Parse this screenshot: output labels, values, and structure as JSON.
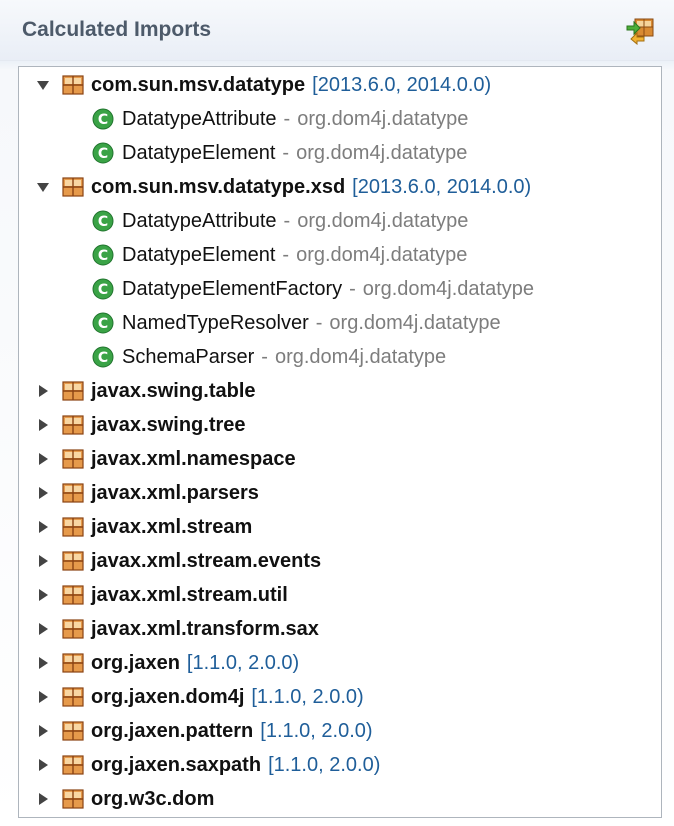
{
  "title": "Calculated Imports",
  "header_icon": "refresh-imports-icon",
  "tree": [
    {
      "name": "com.sun.msv.datatype",
      "version": "[2013.6.0, 2014.0.0)",
      "expanded": true,
      "classes": [
        {
          "name": "DatatypeAttribute",
          "sep": "-",
          "pkg": "org.dom4j.datatype"
        },
        {
          "name": "DatatypeElement",
          "sep": "-",
          "pkg": "org.dom4j.datatype"
        }
      ]
    },
    {
      "name": "com.sun.msv.datatype.xsd",
      "version": "[2013.6.0, 2014.0.0)",
      "expanded": true,
      "classes": [
        {
          "name": "DatatypeAttribute",
          "sep": "-",
          "pkg": "org.dom4j.datatype"
        },
        {
          "name": "DatatypeElement",
          "sep": "-",
          "pkg": "org.dom4j.datatype"
        },
        {
          "name": "DatatypeElementFactory",
          "sep": "-",
          "pkg": "org.dom4j.datatype"
        },
        {
          "name": "NamedTypeResolver",
          "sep": "-",
          "pkg": "org.dom4j.datatype"
        },
        {
          "name": "SchemaParser",
          "sep": "-",
          "pkg": "org.dom4j.datatype"
        }
      ]
    },
    {
      "name": "javax.swing.table",
      "version": "",
      "expanded": false,
      "classes": []
    },
    {
      "name": "javax.swing.tree",
      "version": "",
      "expanded": false,
      "classes": []
    },
    {
      "name": "javax.xml.namespace",
      "version": "",
      "expanded": false,
      "classes": []
    },
    {
      "name": "javax.xml.parsers",
      "version": "",
      "expanded": false,
      "classes": []
    },
    {
      "name": "javax.xml.stream",
      "version": "",
      "expanded": false,
      "classes": []
    },
    {
      "name": "javax.xml.stream.events",
      "version": "",
      "expanded": false,
      "classes": []
    },
    {
      "name": "javax.xml.stream.util",
      "version": "",
      "expanded": false,
      "classes": []
    },
    {
      "name": "javax.xml.transform.sax",
      "version": "",
      "expanded": false,
      "classes": []
    },
    {
      "name": "org.jaxen",
      "version": "[1.1.0, 2.0.0)",
      "expanded": false,
      "classes": []
    },
    {
      "name": "org.jaxen.dom4j",
      "version": "[1.1.0, 2.0.0)",
      "expanded": false,
      "classes": []
    },
    {
      "name": "org.jaxen.pattern",
      "version": "[1.1.0, 2.0.0)",
      "expanded": false,
      "classes": []
    },
    {
      "name": "org.jaxen.saxpath",
      "version": "[1.1.0, 2.0.0)",
      "expanded": false,
      "classes": []
    },
    {
      "name": "org.w3c.dom",
      "version": "",
      "expanded": false,
      "classes": []
    }
  ],
  "colors": {
    "version": "#1f5e99",
    "class_icon": "#3aa346",
    "package_icon": "#c96f1e"
  }
}
